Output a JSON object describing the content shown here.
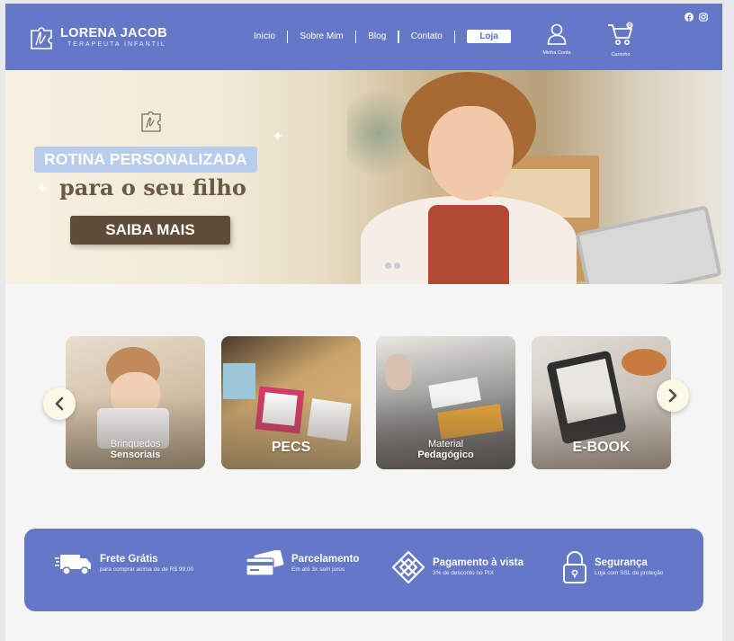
{
  "header": {
    "brand_name": "LORENA JACOB",
    "brand_tagline": "TERAPEUTA INFANTIL",
    "nav": [
      "Início",
      "Sobre Mim",
      "Blog",
      "Contato"
    ],
    "shop_label": "Loja",
    "account_label": "Minha Conta",
    "cart_label": "Carrinho",
    "cart_count": "0",
    "social": [
      "facebook-icon",
      "instagram-icon"
    ]
  },
  "hero": {
    "banner": "ROTINA PERSONALIZADA",
    "subtitle": "para o seu filho",
    "cta": "SAIBA MAIS",
    "slides": 3,
    "active_slide": 1
  },
  "categories": [
    {
      "line1": "Brinquedos",
      "line2": "Sensoriais"
    },
    {
      "line1": "PECS",
      "line2": ""
    },
    {
      "line1": "Material",
      "line2": "Pedagógico"
    },
    {
      "line1": "E-BOOK",
      "line2": ""
    }
  ],
  "features": [
    {
      "title": "Frete Grátis",
      "sub": "para comprar acima de de R$ 99,00",
      "icon": "truck-icon"
    },
    {
      "title": "Parcelamento",
      "sub": "Em até 3x sem juros",
      "icon": "credit-card-icon"
    },
    {
      "title": "Pagamento à vista",
      "sub": "3% de desconto no PIX",
      "icon": "pix-icon"
    },
    {
      "title": "Segurança",
      "sub": "Loja com SSL de proteção",
      "icon": "lock-icon"
    }
  ],
  "colors": {
    "brand_blue": "#6578c8",
    "hero_button": "#5f4c38",
    "hero_banner": "#b8ccec",
    "arrow_bg": "#fbf9e7"
  }
}
